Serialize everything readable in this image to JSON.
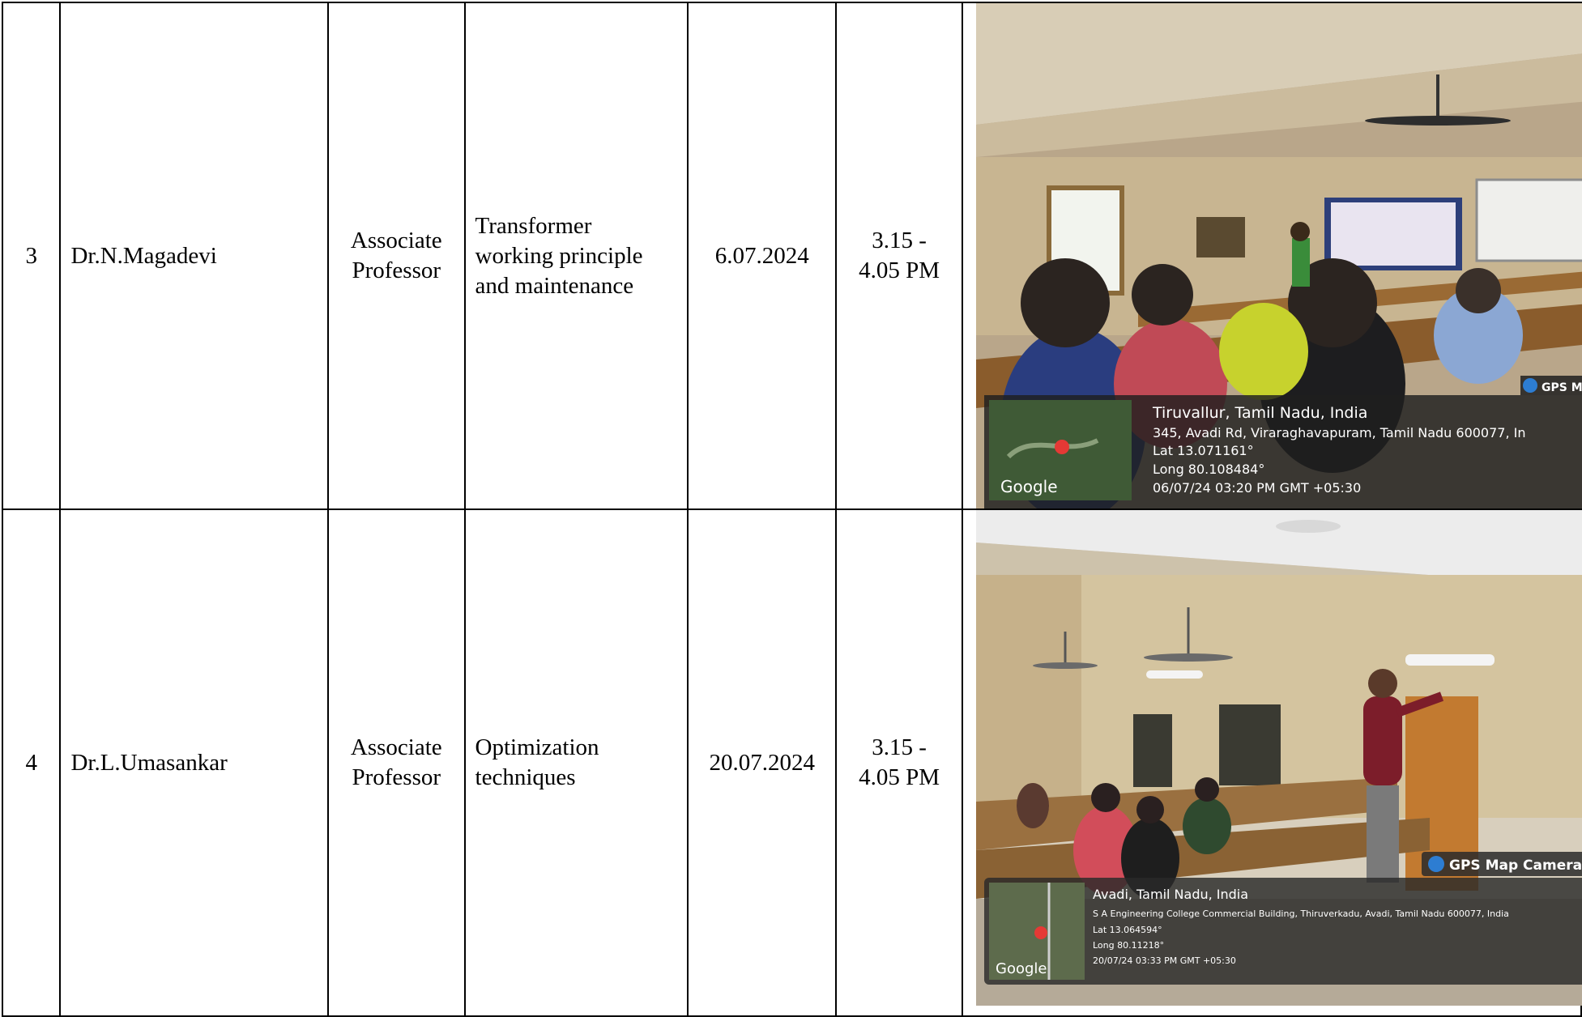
{
  "rows": [
    {
      "sno": "3",
      "name": "Dr.N.Magadevi",
      "designation": [
        "Associate",
        "Professor"
      ],
      "topic": [
        "Transformer",
        "working principle",
        "and maintenance"
      ],
      "date": "6.07.2024",
      "time": [
        "3.15 -",
        "4.05 PM"
      ],
      "photo": {
        "app": "GPS Map",
        "place": "Tiruvallur, Tamil Nadu, India",
        "address": "345, Avadi Rd, Viraraghavapuram, Tamil Nadu 600077, In",
        "lat": "Lat 13.071161°",
        "long": "Long 80.108484°",
        "timestamp": "06/07/24 03:20 PM GMT +05:30",
        "map_logo": "Google"
      }
    },
    {
      "sno": "4",
      "name": "Dr.L.Umasankar",
      "designation": [
        "Associate",
        "Professor"
      ],
      "topic": [
        "Optimization",
        "techniques"
      ],
      "date": "20.07.2024",
      "time": [
        "3.15 -",
        "4.05 PM"
      ],
      "photo": {
        "app": "GPS Map Camera",
        "place": "Avadi, Tamil Nadu, India",
        "address": "S A Engineering College Commercial Building, Thiruverkadu, Avadi, Tamil Nadu 600077, India",
        "lat": "Lat 13.064594°",
        "long": "Long 80.11218°",
        "timestamp": "20/07/24 03:33 PM GMT +05:30",
        "map_logo": "Google"
      }
    }
  ]
}
